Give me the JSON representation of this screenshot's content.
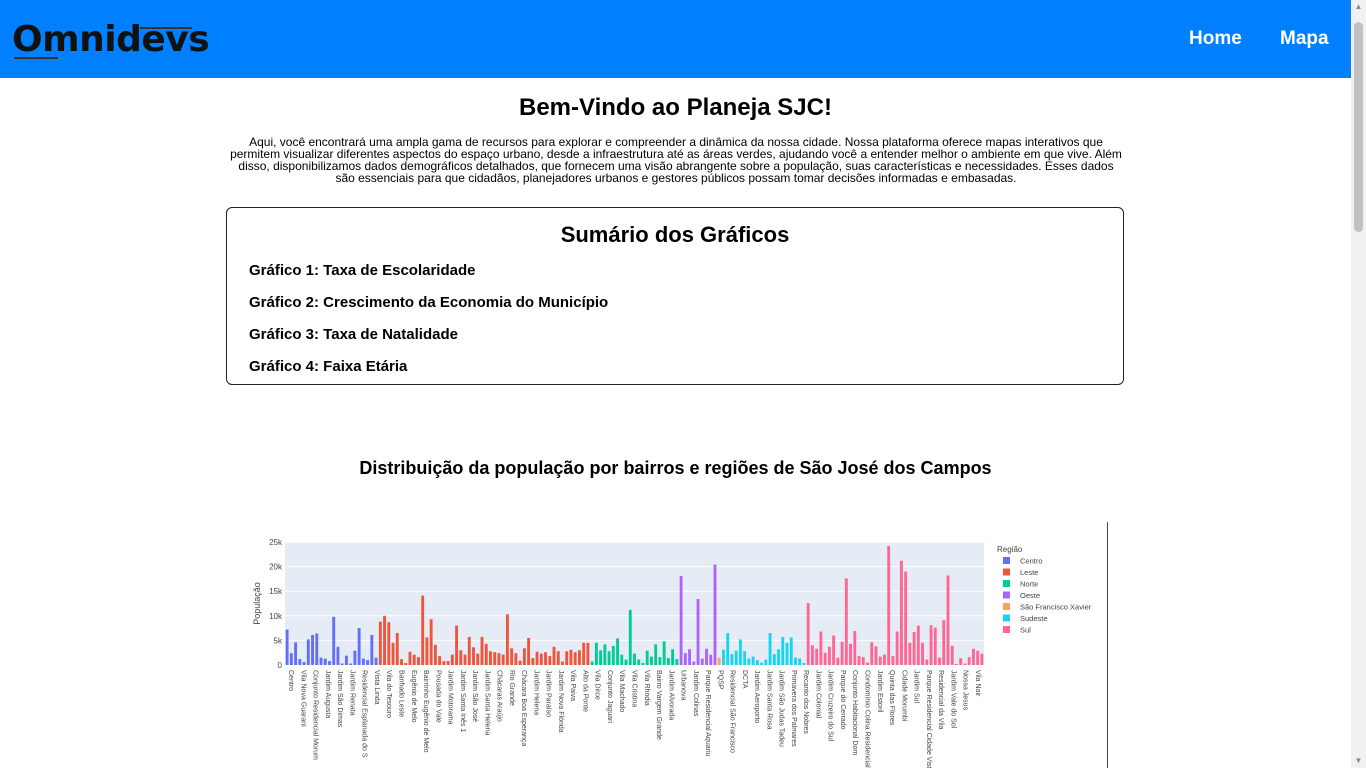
{
  "brand": {
    "logo_text": "Omnidevs"
  },
  "nav": {
    "home": "Home",
    "map": "Mapa"
  },
  "page": {
    "title": "Bem-Vindo ao Planeja SJC!",
    "intro": "Aqui, você encontrará uma ampla gama de recursos para explorar e compreender a dinâmica da nossa cidade. Nossa plataforma oferece mapas interativos que permitem visualizar diferentes aspectos do espaço urbano, desde a infraestrutura até as áreas verdes, ajudando você a entender melhor o ambiente em que vive. Além disso, disponibilizamos dados demográficos detalhados, que fornecem uma visão abrangente sobre a população, suas características e necessidades. Esses dados são essenciais para que cidadãos, planejadores urbanos e gestores públicos possam tomar decisões informadas e embasadas."
  },
  "summary": {
    "title": "Sumário dos Gráficos",
    "items": [
      "Gráfico 1: Taxa de Escolaridade",
      "Gráfico 2: Crescimento da Economia do Município",
      "Gráfico 3: Taxa de Natalidade",
      "Gráfico 4: Faixa Etária"
    ]
  },
  "colors": {
    "nav_bg": "#0080ff",
    "plot_bg": "#e5ecf6",
    "Centro": "#636efa",
    "Leste": "#ef553b",
    "Norte": "#00cc96",
    "Oeste": "#ab63fa",
    "Sao Francisco Xavier": "#ffa15a",
    "Sudeste": "#19d3f3",
    "Sul": "#ff6692"
  },
  "chart_data": {
    "type": "bar",
    "title": "Distribuição da população por bairros e regiões de São José dos Campos",
    "xlabel": "",
    "ylabel": "População",
    "ylim": [
      0,
      25000
    ],
    "yticks": [
      "0",
      "5k",
      "10k",
      "15k",
      "20k",
      "25k"
    ],
    "grid": true,
    "legend_title": "Região",
    "legend_position": "right",
    "x_tick_labels": [
      "Centro",
      "Vila Nova Guarani",
      "Conjunto Residencial Morum",
      "Jardim Augusta",
      "Jardim São Dimas",
      "Jardim Renata",
      "Residencial Esplanada do S",
      "Vista Linda",
      "Vila do Tesouro",
      "Banhado Leste",
      "Eugênio de Melo",
      "Bairrinho Eugênio de Melo",
      "Pousada do Vale",
      "Jardim Motorama",
      "Jardim Santa Inês 1",
      "Jardim São José",
      "Jardim Santa Helena",
      "Chácaras Araújo",
      "Rio Grande",
      "Chácara Boa Esperança",
      "Jardim Helena",
      "Jardim Paraíso",
      "Jardim Nova Flórida",
      "Vila Paiva",
      "Alto da Ponte",
      "Vila Dirce",
      "Conjunto Jaguari",
      "Vila Machado",
      "Vila Cristina",
      "Vila Rhodia",
      "Bairro Vargem Grande",
      "Jardim Alvorada",
      "Urbanova",
      "Jardim Colinas",
      "Parque Residencial Aquariu",
      "PQSP",
      "Residencial São Francisco",
      "DCTA",
      "Jardim Aeroporto",
      "Jardim Santa Rosa",
      "Jardim São Judas Tadeu",
      "Primavera dos Palmares",
      "Recanto dos Nobres",
      "Jardim Colonial",
      "Jardim Cruzeiro do Sul",
      "Parque do Cerrado",
      "Conjunto Habitacional Dom",
      "Condomínio Colina Residencial",
      "Jardim Estoril",
      "Quinta das Flores",
      "Cidade Morumbi",
      "Jardim Sul",
      "Parque Residencial Cidade Vista",
      "Residencial da Vila",
      "Jardim Vale do Sol",
      "Nossa Jesus",
      "Vila Nair"
    ],
    "series": [
      {
        "name": "Centro",
        "values": [
          7200,
          2400,
          4600,
          1200,
          600,
          5200,
          6100,
          6400,
          1500,
          1300,
          800,
          9800,
          3700,
          300,
          1900,
          300,
          2900,
          7500,
          1300,
          1000,
          6100,
          1500
        ]
      },
      {
        "name": "Leste",
        "values": [
          8800,
          10000,
          8700,
          4500,
          6500,
          1200,
          400,
          2700,
          2100,
          1600,
          14100,
          5600,
          9300,
          4100,
          1800,
          800,
          800,
          2100,
          8000,
          3000,
          2100,
          5700,
          3600,
          2300,
          5700,
          4300,
          2800,
          2600,
          2400,
          2100,
          10300,
          3400,
          2400,
          900,
          3400,
          5500,
          1400,
          2700,
          2300,
          2600,
          1800,
          3700,
          2800,
          700,
          2800,
          3100,
          2600,
          3000,
          4500,
          4500
        ]
      },
      {
        "name": "Norte",
        "values": [
          700,
          4500,
          3000,
          4200,
          2800,
          3900,
          5400,
          2100,
          1100,
          11200,
          2300,
          1100,
          400,
          2900,
          1700,
          4200,
          1600,
          4800,
          1400,
          3200,
          1200
        ]
      },
      {
        "name": "Oeste",
        "values": [
          18100,
          2400,
          3200,
          700,
          13400,
          1300,
          3300,
          2100,
          20400
        ]
      },
      {
        "name": "Sao Francisco Xavier",
        "values": [
          1500
        ]
      },
      {
        "name": "Sudeste",
        "values": [
          3100,
          6500,
          2200,
          2900,
          5200,
          2800,
          1300,
          1700,
          1000,
          500,
          1100,
          6500,
          2200,
          3200,
          5700,
          4500,
          5600,
          1500,
          1300,
          400
        ]
      },
      {
        "name": "Sul",
        "values": [
          12600,
          4000,
          3300,
          6800,
          2500,
          3700,
          6000,
          1500,
          4700,
          17600,
          4300,
          6900,
          1800,
          1600,
          500,
          4600,
          3800,
          1700,
          2100,
          24200,
          1800,
          6800,
          21200,
          19000,
          4500,
          6700,
          8000,
          4500,
          1100,
          8100,
          7600,
          1500,
          9100,
          18200,
          3900,
          200,
          1400,
          300,
          1600,
          3300,
          2900,
          2300
        ]
      }
    ]
  }
}
